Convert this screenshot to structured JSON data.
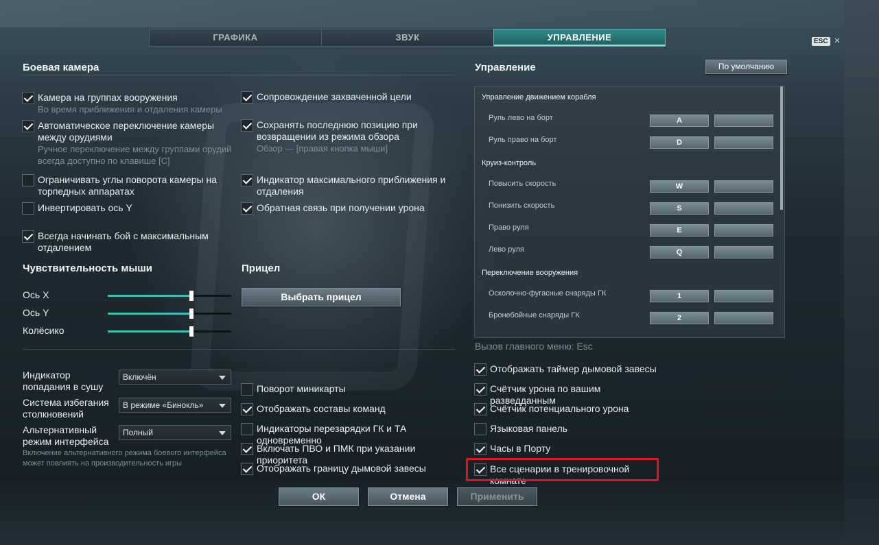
{
  "tabs": [
    "ГРАФИКА",
    "ЗВУК",
    "УПРАВЛЕНИЕ"
  ],
  "active_tab": "УПРАВЛЕНИЕ",
  "esc_key": "ESC",
  "close_glyph": "×",
  "battle_camera": {
    "title": "Боевая камера",
    "left": [
      {
        "label": "Камера на группах вооружения",
        "sub": "Во время приближения и отдаления камеры",
        "checked": true
      },
      {
        "label": "Автоматическое переключение камеры между орудиями",
        "sub": "Ручное переключение между группами орудий всегда доступно по клавише [C]",
        "checked": true
      },
      {
        "label": "Ограничивать углы поворота камеры на торпедных аппаратах",
        "sub": "",
        "checked": false
      },
      {
        "label": "Инвертировать ось Y",
        "sub": "",
        "checked": false
      },
      {
        "label": "Всегда начинать бой с максимальным отдалением",
        "sub": "",
        "checked": true
      }
    ],
    "right": [
      {
        "label": "Сопровождение захваченной цели",
        "sub": "",
        "checked": true
      },
      {
        "label": "Сохранять последнюю позицию при возвращении из режима обзора",
        "sub": "Обзор — [правая кнопка мыши]",
        "checked": true
      },
      {
        "label": "Индикатор максимального приближения и отдаления",
        "sub": "",
        "checked": true
      },
      {
        "label": "Обратная связь при получении урона",
        "sub": "",
        "checked": true
      }
    ]
  },
  "mouse": {
    "title": "Чувствительность мыши",
    "sliders": [
      {
        "label": "Ось X",
        "value": 0.68
      },
      {
        "label": "Ось Y",
        "value": 0.68
      },
      {
        "label": "Колёсико",
        "value": 0.68
      }
    ]
  },
  "sight": {
    "title": "Прицел",
    "button": "Выбрать прицел"
  },
  "dropdowns": [
    {
      "label": "Индикатор попадания в сушу",
      "value": "Включён"
    },
    {
      "label": "Система избегания столкновений",
      "value": "В режиме «Бинокль»"
    },
    {
      "label": "Альтернативный режим интерфейса",
      "value": "Полный"
    }
  ],
  "alt_note": "Включение альтернативного режима боевого интерфейса может повлиять на производительность игры",
  "mid_checks": [
    {
      "label": "Поворот миникарты",
      "checked": false
    },
    {
      "label": "Отображать составы команд",
      "checked": true
    },
    {
      "label": "Индикаторы перезарядки ГК и ТА одновременно",
      "checked": false
    },
    {
      "label": "Включать ПВО и ПМК при указании приоритета",
      "checked": true
    },
    {
      "label": "Отображать границу дымовой завесы",
      "checked": true
    }
  ],
  "controls": {
    "title": "Управление",
    "default_button": "По умолчанию",
    "groups": [
      {
        "title": "Управление движением корабля",
        "rows": [
          {
            "name": "Руль лево на борт",
            "key1": "A",
            "key2": ""
          },
          {
            "name": "Руль право на борт",
            "key1": "D",
            "key2": ""
          }
        ]
      },
      {
        "title": "Круиз-контроль",
        "rows": [
          {
            "name": "Повысить скорость",
            "key1": "W",
            "key2": ""
          },
          {
            "name": "Понизить скорость",
            "key1": "S",
            "key2": ""
          },
          {
            "name": "Право руля",
            "key1": "E",
            "key2": ""
          },
          {
            "name": "Лево руля",
            "key1": "Q",
            "key2": ""
          }
        ]
      },
      {
        "title": "Переключение вооружения",
        "rows": [
          {
            "name": "Осколочно-фугасные снаряды ГК",
            "key1": "1",
            "key2": ""
          },
          {
            "name": "Бронебойные снаряды ГК",
            "key1": "2",
            "key2": ""
          }
        ]
      }
    ],
    "menu_hint": "Вызов главного меню: Esc"
  },
  "right_checks": [
    {
      "label": "Отображать таймер дымовой завесы",
      "checked": true
    },
    {
      "label": "Счётчик урона по вашим разведданным",
      "checked": true
    },
    {
      "label": "Счётчик потенциального урона",
      "checked": true
    },
    {
      "label": "Языковая панель",
      "checked": false
    },
    {
      "label": "Часы в Порту",
      "checked": true
    },
    {
      "label": "Все сценарии в тренировочной комнате",
      "checked": true
    }
  ],
  "footer": {
    "ok": "ОК",
    "cancel": "Отмена",
    "apply": "Применить"
  },
  "colors": {
    "accent": "#3fc2b1",
    "tab_active": "#2f8b88",
    "highlight": "#e0141b"
  }
}
